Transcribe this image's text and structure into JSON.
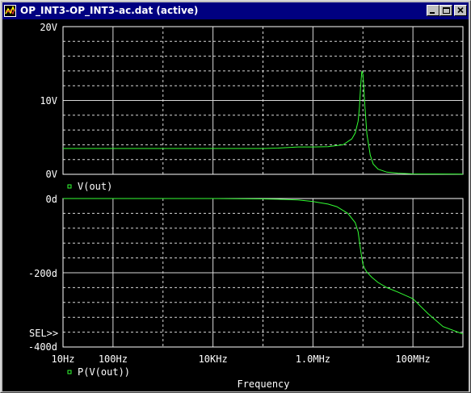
{
  "window": {
    "title": "OP_INT3-OP_INT3-ac.dat (active)",
    "icons": [
      "probe-app-icon",
      "minimize-icon",
      "maximize-icon",
      "close-icon"
    ]
  },
  "colors": {
    "background": "#000000",
    "grid": "#d8d8d8",
    "trace": "#33ff33",
    "text": "#ffffff",
    "titlebar": "#000080"
  },
  "x_axis": {
    "label": "Frequency",
    "scale": "log",
    "tick_labels": [
      "10Hz",
      "100Hz",
      "10KHz",
      "1.0MHz",
      "100MHz"
    ],
    "tick_values_hz": [
      10,
      100,
      10000,
      1000000,
      100000000
    ],
    "range_hz": [
      10,
      1000000000
    ]
  },
  "upper_plot": {
    "trace_label": "V(out)",
    "y_tick_labels": [
      "20V",
      "10V",
      "0V"
    ],
    "ylim": [
      0,
      20
    ]
  },
  "lower_plot": {
    "trace_label": "P(V(out))",
    "y_tick_labels": [
      "0d",
      "-200d",
      "-400d"
    ],
    "ylim": [
      -400,
      0
    ],
    "selected_marker": "SEL>>"
  },
  "chart_data": [
    {
      "type": "line",
      "title": "",
      "xlabel": "Frequency",
      "ylabel": "",
      "xscale": "log",
      "xlim": [
        10,
        1000000000
      ],
      "ylim": [
        0,
        20
      ],
      "grid": true,
      "series": [
        {
          "name": "V(out)",
          "x": [
            10,
            100,
            1000,
            10000,
            100000,
            200000,
            500000,
            1000000,
            2000000,
            4000000,
            6000000,
            7000000,
            8000000,
            8500000,
            9000000,
            9500000,
            10000000,
            11000000,
            12000000,
            14000000,
            16000000,
            20000000,
            30000000,
            50000000,
            100000000,
            1000000000
          ],
          "y": [
            3.5,
            3.5,
            3.5,
            3.5,
            3.5,
            3.55,
            3.7,
            3.7,
            3.75,
            4.0,
            4.8,
            5.6,
            7.2,
            9.0,
            12.0,
            14.0,
            13.5,
            9.0,
            5.5,
            2.6,
            1.4,
            0.7,
            0.3,
            0.15,
            0.05,
            0.02
          ]
        }
      ]
    },
    {
      "type": "line",
      "title": "",
      "xlabel": "Frequency",
      "ylabel": "",
      "xscale": "log",
      "xlim": [
        10,
        1000000000
      ],
      "ylim": [
        -400,
        0
      ],
      "grid": true,
      "series": [
        {
          "name": "P(V(out))",
          "x": [
            10,
            100,
            1000,
            10000,
            100000,
            200000,
            500000,
            1000000,
            2000000,
            3000000,
            5000000,
            7000000,
            8000000,
            9000000,
            10000000,
            11000000,
            12000000,
            15000000,
            20000000,
            30000000,
            50000000,
            100000000,
            200000000,
            400000000,
            1000000000
          ],
          "y": [
            0,
            0,
            0,
            0,
            -1,
            -2,
            -4,
            -8,
            -15,
            -22,
            -40,
            -65,
            -90,
            -140,
            -178,
            -190,
            -198,
            -212,
            -226,
            -240,
            -252,
            -270,
            -310,
            -345,
            -365
          ]
        }
      ]
    }
  ]
}
